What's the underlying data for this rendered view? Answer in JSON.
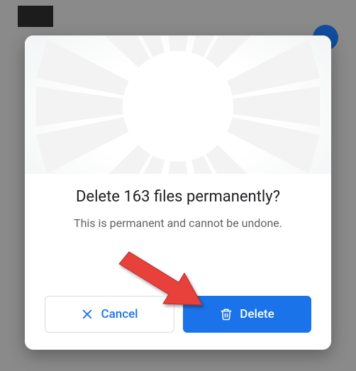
{
  "dialog": {
    "title": "Delete 163 files permanently?",
    "subtitle": "This is permanent and cannot be undone.",
    "cancel_label": "Cancel",
    "delete_label": "Delete"
  },
  "colors": {
    "primary": "#1a73e8",
    "text_primary": "#202124",
    "text_secondary": "#5f6368",
    "border": "#dadce0",
    "annotation": "#e8413a"
  }
}
